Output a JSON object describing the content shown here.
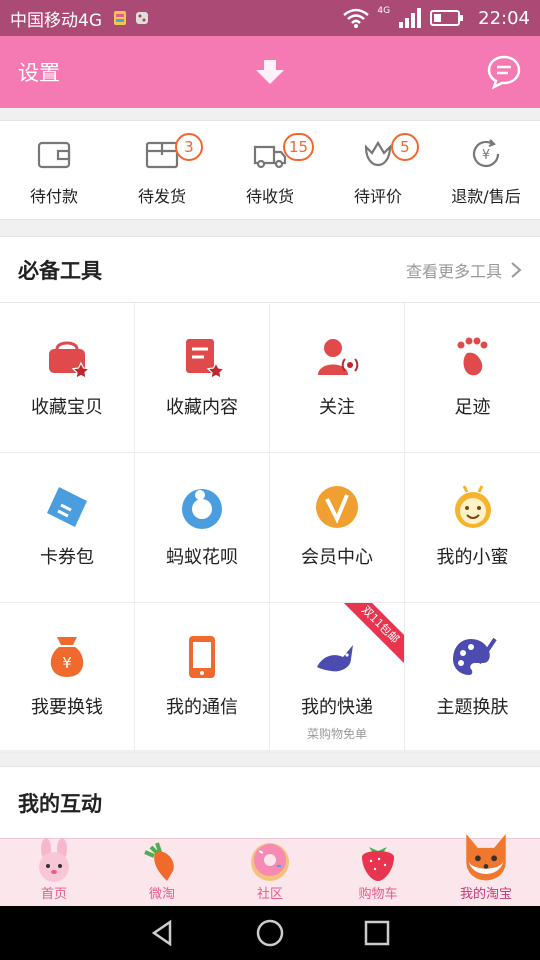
{
  "status_bar": {
    "carrier": "中国移动4G",
    "network": "4G",
    "time": "22:04",
    "icons": [
      "notification-app-icon",
      "notification-dice-icon",
      "wifi-icon",
      "signal-icon",
      "battery-icon"
    ]
  },
  "header": {
    "title": "设置",
    "center_icon": "down-arrow-icon",
    "right_icon": "message-icon",
    "background": "#f57ab4"
  },
  "orders": {
    "items": [
      {
        "label": "待付款",
        "icon": "wallet-icon",
        "badge": ""
      },
      {
        "label": "待发货",
        "icon": "box-icon",
        "badge": "3"
      },
      {
        "label": "待收货",
        "icon": "truck-icon",
        "badge": "15"
      },
      {
        "label": "待评价",
        "icon": "flower-icon",
        "badge": "5"
      },
      {
        "label": "退款/售后",
        "icon": "refund-icon",
        "badge": ""
      }
    ],
    "badge_color": "#f0682e"
  },
  "tools": {
    "title": "必备工具",
    "more": "查看更多工具",
    "items": [
      {
        "label": "收藏宝贝",
        "icon": "bag-star-icon",
        "sub": "",
        "ribbon": ""
      },
      {
        "label": "收藏内容",
        "icon": "doc-star-icon",
        "sub": "",
        "ribbon": ""
      },
      {
        "label": "关注",
        "icon": "person-follow-icon",
        "sub": "",
        "ribbon": ""
      },
      {
        "label": "足迹",
        "icon": "footprint-icon",
        "sub": "",
        "ribbon": ""
      },
      {
        "label": "卡券包",
        "icon": "ticket-icon",
        "sub": "",
        "ribbon": ""
      },
      {
        "label": "蚂蚁花呗",
        "icon": "ant-huabei-icon",
        "sub": "",
        "ribbon": ""
      },
      {
        "label": "会员中心",
        "icon": "vip-icon",
        "sub": "",
        "ribbon": ""
      },
      {
        "label": "我的小蜜",
        "icon": "bee-icon",
        "sub": "",
        "ribbon": ""
      },
      {
        "label": "我要换钱",
        "icon": "money-bag-icon",
        "sub": "",
        "ribbon": ""
      },
      {
        "label": "我的通信",
        "icon": "phone-icon",
        "sub": "",
        "ribbon": ""
      },
      {
        "label": "我的快递",
        "icon": "bird-icon",
        "sub": "菜购物免单",
        "ribbon": "双11包邮"
      },
      {
        "label": "主题换肤",
        "icon": "palette-icon",
        "sub": "",
        "ribbon": ""
      }
    ]
  },
  "interact": {
    "title": "我的互动"
  },
  "tabbar": {
    "items": [
      {
        "label": "首页",
        "icon": "rabbit-icon"
      },
      {
        "label": "微淘",
        "icon": "carrot-icon"
      },
      {
        "label": "社区",
        "icon": "donut-icon"
      },
      {
        "label": "购物车",
        "icon": "strawberry-icon"
      },
      {
        "label": "我的淘宝",
        "icon": "fox-icon"
      }
    ]
  },
  "navbar": {
    "icons": [
      "back-icon",
      "home-icon",
      "recents-icon"
    ]
  }
}
